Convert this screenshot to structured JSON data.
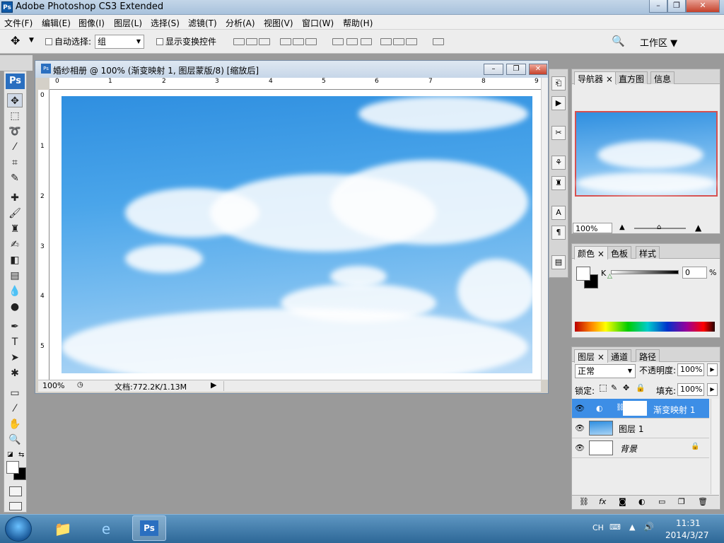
{
  "window": {
    "title": "Adobe Photoshop CS3 Extended",
    "app_icon": "Ps",
    "min": "–",
    "max": "❐",
    "close": "✕"
  },
  "menu": [
    "文件(F)",
    "编辑(E)",
    "图像(I)",
    "图层(L)",
    "选择(S)",
    "滤镜(T)",
    "分析(A)",
    "视图(V)",
    "窗口(W)",
    "帮助(H)"
  ],
  "options": {
    "auto_select_label": "自动选择:",
    "auto_select_value": "组",
    "show_transform_label": "显示变换控件",
    "workspace_label": "工作区"
  },
  "toolbox": {
    "logo": "Ps"
  },
  "document": {
    "title": "婚纱相册 @ 100% (渐变映射 1, 图层蒙版/8) [缩放后]",
    "ruler_top": [
      "0",
      "1",
      "2",
      "3",
      "4",
      "5",
      "6",
      "7",
      "8",
      "9"
    ],
    "ruler_left": [
      "0",
      "1",
      "2",
      "3",
      "4",
      "5"
    ],
    "zoom": "100%",
    "doc_info": "文档:772.2K/1.13M"
  },
  "navigator": {
    "tabs": [
      "导航器",
      "直方图",
      "信息"
    ],
    "zoom": "100%"
  },
  "color": {
    "tabs": [
      "颜色",
      "色板",
      "样式"
    ],
    "channel": "K",
    "value": "0",
    "unit": "%"
  },
  "layers": {
    "tabs": [
      "图层",
      "通道",
      "路径"
    ],
    "blend_mode": "正常",
    "opacity_label": "不透明度:",
    "opacity": "100%",
    "lock_label": "锁定:",
    "fill_label": "填充:",
    "fill": "100%",
    "items": [
      {
        "name": "渐变映射 1",
        "selected": true
      },
      {
        "name": "图层 1",
        "selected": false
      },
      {
        "name": "背景",
        "selected": false
      }
    ],
    "footer_icons": [
      "link-icon",
      "fx-icon",
      "mask-icon",
      "adjustment-icon",
      "folder-icon",
      "new-layer-icon",
      "trash-icon"
    ]
  },
  "taskbar": {
    "tray_lang": "CH",
    "time": "11:31",
    "date": "2014/3/27"
  }
}
